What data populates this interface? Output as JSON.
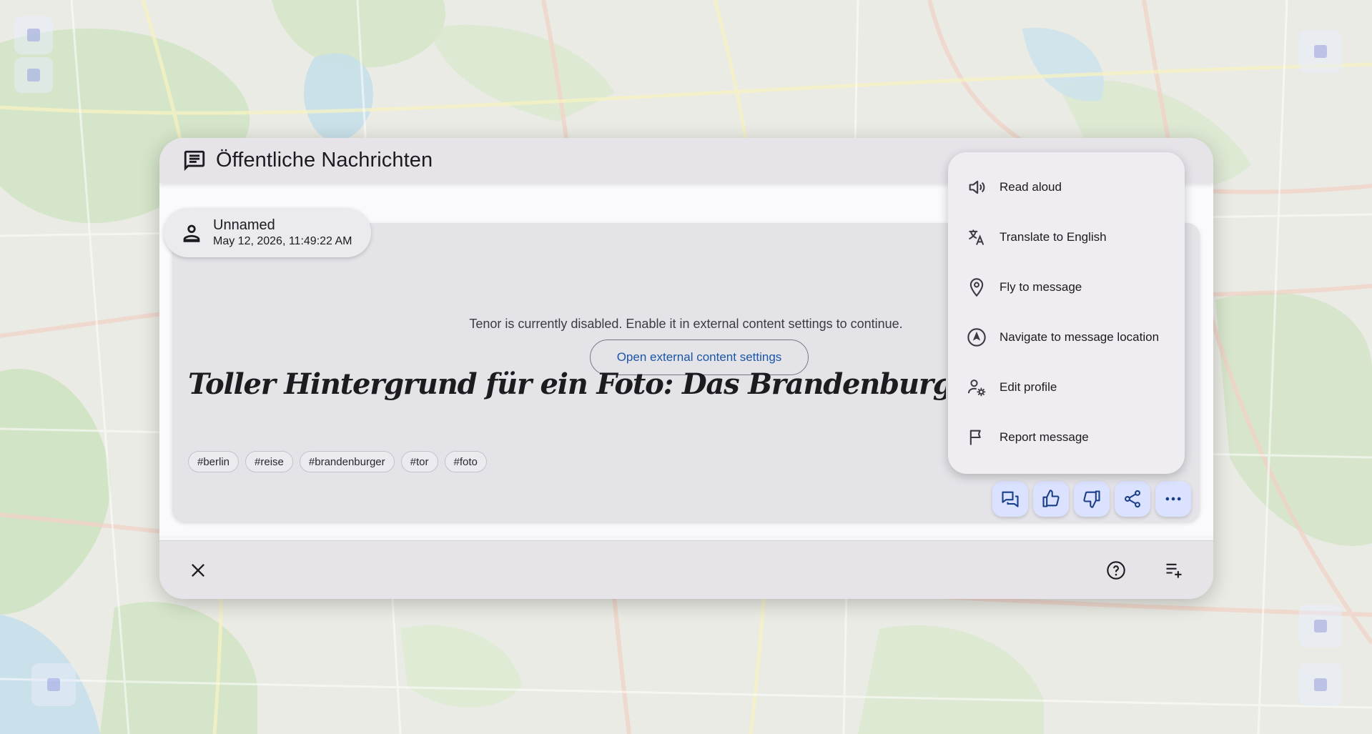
{
  "dialog": {
    "title": "Öffentliche Nachrichten"
  },
  "message": {
    "author": "Unnamed",
    "timestamp": "May 12, 2026, 11:49:22 AM",
    "tenor_notice": "Tenor is currently disabled. Enable it in external content settings to continue.",
    "open_settings_label": "Open external content settings",
    "text": "Toller Hintergrund für ein Foto: Das Brandenburger Tor - schönes historisches Motiv",
    "tags": [
      "#berlin",
      "#reise",
      "#brandenburger",
      "#tor",
      "#foto"
    ]
  },
  "actions": [
    {
      "name": "comment-button",
      "icon": "chat-icon"
    },
    {
      "name": "like-button",
      "icon": "thumbs-up-icon"
    },
    {
      "name": "dislike-button",
      "icon": "thumbs-down-icon"
    },
    {
      "name": "share-button",
      "icon": "share-icon"
    },
    {
      "name": "more-button",
      "icon": "more-horiz-icon"
    }
  ],
  "context_menu": {
    "items": [
      {
        "label": "Read aloud",
        "icon": "volume-icon"
      },
      {
        "label": "Translate to English",
        "icon": "translate-icon"
      },
      {
        "label": "Fly to message",
        "icon": "location-pin-icon"
      },
      {
        "label": "Navigate to message location",
        "icon": "navigation-icon"
      },
      {
        "label": "Edit profile",
        "icon": "settings-account-icon"
      },
      {
        "label": "Report message",
        "icon": "flag-icon"
      }
    ]
  },
  "footer": {
    "close_icon": "close-icon",
    "help_icon": "help-icon",
    "add_message_icon": "playlist-add-icon"
  },
  "colors": {
    "accent": "#1a55a6",
    "action_bg": "#dbe2ff",
    "icon": "#1a3f8a"
  }
}
